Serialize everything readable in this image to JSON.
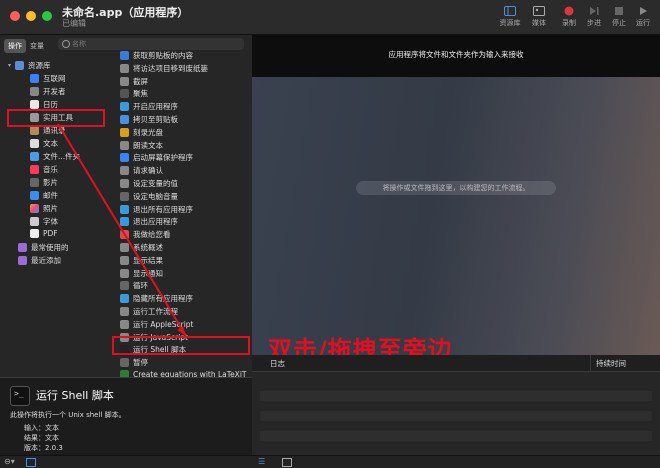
{
  "window": {
    "title": "未命名.app（应用程序）",
    "subtitle": "已编辑"
  },
  "toolbar": {
    "library": "资源库",
    "media": "媒体",
    "record": "录制",
    "step": "步进",
    "stop": "停止",
    "run": "运行"
  },
  "library": {
    "tab_actions": "操作",
    "tab_variables": "变量",
    "search_placeholder": "名称",
    "root": "资源库",
    "categories": [
      "互联网",
      "开发者",
      "日历",
      "实用工具",
      "通讯录",
      "文本",
      "文件...件夹",
      "音乐",
      "影片",
      "邮件",
      "照片",
      "字体",
      "PDF"
    ],
    "recent": "最常使用的",
    "recently_added": "最近添加"
  },
  "actions": [
    "获取剪贴板的内容",
    "将访达项目移到废纸篓",
    "截屏",
    "聚焦",
    "开启应用程序",
    "拷贝至剪贴板",
    "刻录光盘",
    "朗读文本",
    "启动屏幕保护程序",
    "请求确认",
    "设定变量的值",
    "设定电脑音量",
    "退出所有应用程序",
    "退出应用程序",
    "我做给您看",
    "系统概述",
    "显示结果",
    "显示通知",
    "循环",
    "隐藏所有应用程序",
    "运行工作流程",
    "运行 AppleScript",
    "运行 JavaScript",
    "运行 Shell 脚本",
    "暂停",
    "Create equations with LaTeXiT"
  ],
  "annotation": "双击/拖拽至旁边",
  "workflow": {
    "header": "应用程序将文件和文件夹作为输入来接收",
    "drop_hint": "将操作或文件拖到这里，以构建您的工作流程。"
  },
  "log": {
    "col_log": "日志",
    "col_duration": "持续时间"
  },
  "description": {
    "title": "运行 Shell 脚本",
    "text": "此操作将执行一个 Unix shell 脚本。",
    "input_label": "输入：",
    "input_value": "文本",
    "result_label": "结果：",
    "result_value": "文本",
    "version_label": "版本：",
    "version_value": "2.0.3"
  }
}
